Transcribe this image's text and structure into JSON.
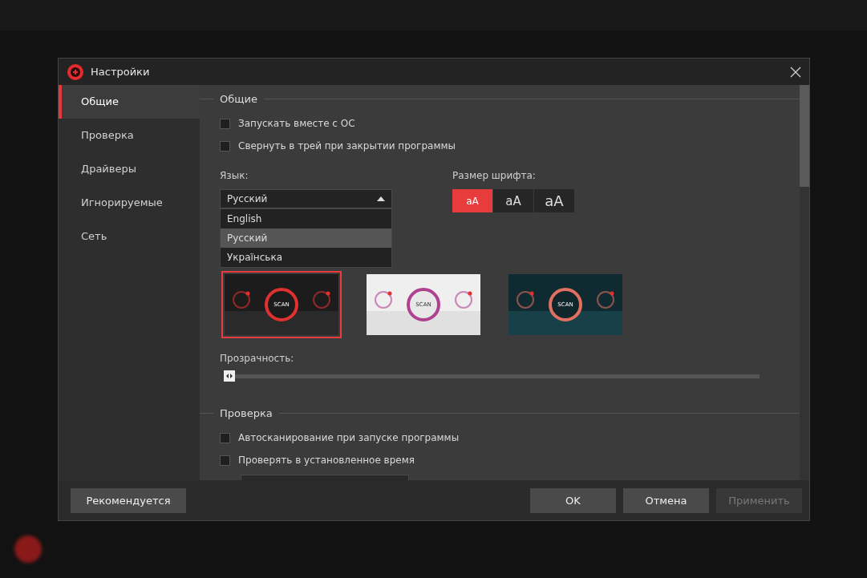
{
  "dialog": {
    "title": "Настройки"
  },
  "sidebar": {
    "items": [
      {
        "label": "Общие",
        "selected": true
      },
      {
        "label": "Проверка",
        "selected": false
      },
      {
        "label": "Драйверы",
        "selected": false
      },
      {
        "label": "Игнорируемые",
        "selected": false
      },
      {
        "label": "Сеть",
        "selected": false
      }
    ]
  },
  "general": {
    "heading": "Общие",
    "options": [
      {
        "label": "Запускать вместе с ОС",
        "checked": false
      },
      {
        "label": "Свернуть в трей при закрытии программы",
        "checked": false
      }
    ],
    "language": {
      "label": "Язык:",
      "value": "Русский",
      "expanded": true,
      "options": [
        {
          "label": "English",
          "selected": false
        },
        {
          "label": "Русский",
          "selected": true
        },
        {
          "label": "Українська",
          "selected": false
        }
      ]
    },
    "font_size": {
      "label": "Размер шрифта:",
      "options": [
        {
          "label": "aA",
          "selected": true
        },
        {
          "label": "aA",
          "selected": false
        },
        {
          "label": "aA",
          "selected": false
        }
      ]
    },
    "skins": [
      {
        "kind": "dark",
        "button": "SCAN",
        "selected": true
      },
      {
        "kind": "light",
        "button": "SCAN",
        "selected": false
      },
      {
        "kind": "teal",
        "button": "SCAN",
        "selected": false
      }
    ],
    "transparency": {
      "label": "Прозрачность:",
      "level": 0.01
    }
  },
  "scan": {
    "heading": "Проверка",
    "options": [
      {
        "label": "Автосканирование при запуске программы",
        "checked": false
      },
      {
        "label": "Проверять в установленное время",
        "checked": false
      }
    ]
  },
  "buttons": {
    "recommend": "Рекомендуется",
    "ok": "OK",
    "cancel": "Отмена",
    "apply": {
      "label": "Применить",
      "disabled": true
    }
  }
}
